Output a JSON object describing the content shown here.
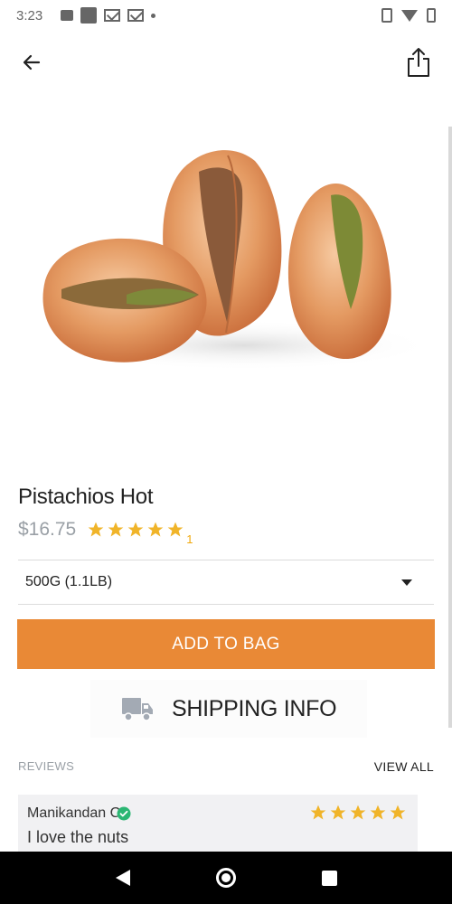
{
  "status_bar": {
    "time": "3:23",
    "icons": [
      "image-icon",
      "square-icon",
      "gmail-icon",
      "gmail-icon",
      "dot-icon",
      "vibrate-icon",
      "wifi-icon",
      "battery-icon"
    ]
  },
  "header": {
    "back_icon": "arrow-left-icon",
    "share_icon": "share-icon"
  },
  "product": {
    "title": "Pistachios Hot",
    "price": "$16.75",
    "rating": 5,
    "rating_count": "1",
    "variant": "500G (1.1LB)"
  },
  "actions": {
    "add_to_bag": "ADD TO BAG",
    "shipping_info": "SHIPPING INFO"
  },
  "reviews": {
    "label": "REVIEWS",
    "view_all": "VIEW ALL",
    "items": [
      {
        "name": "Manikandan C.",
        "verified": true,
        "rating": 5,
        "text": "I love the nuts"
      }
    ]
  },
  "colors": {
    "accent": "#e98936",
    "star": "#f0b429",
    "verified": "#2bb673",
    "muted_text": "#9aa0a6"
  }
}
